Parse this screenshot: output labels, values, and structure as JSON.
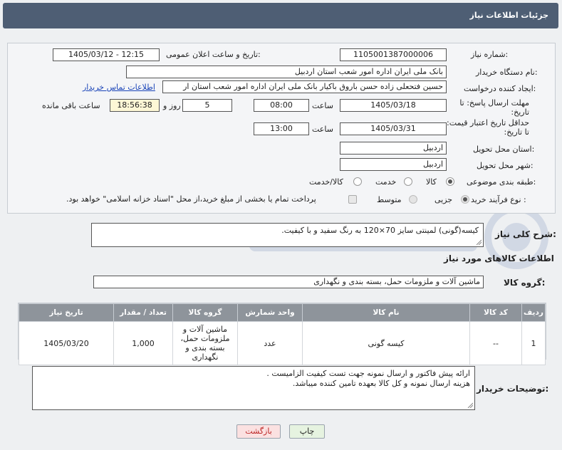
{
  "header": {
    "title": "جزئیات اطلاعات نیاز"
  },
  "form": {
    "need_number_label": "شماره نیاز:",
    "need_number": "1105001387000006",
    "announce_label": "تاریخ و ساعت اعلان عمومی:",
    "announce_value": "1405/03/12 - 12:15",
    "buyer_org_label": "نام دستگاه خریدار:",
    "buyer_org": "بانک ملی ایران اداره امور شعب استان اردبیل",
    "creator_label": "ایجاد کننده درخواست:",
    "creator": "حسین فتحعلی زاده حسن باروق باکیار بانک ملی ایران اداره امور شعب استان ار",
    "contact_link": "اطلاعات تماس خریدار",
    "deadline_label": "مهلت ارسال پاسخ: تا تاریخ:",
    "deadline_date": "1405/03/18",
    "time_label": "ساعت",
    "deadline_time": "08:00",
    "days_value": "5",
    "days_label": "روز و",
    "remaining_value": "18:56:38",
    "remaining_label": "ساعت باقی مانده",
    "validity_label": "حداقل تاریخ اعتبار قیمت: تا تاریخ:",
    "validity_date": "1405/03/31",
    "validity_time": "13:00",
    "province_label": "استان محل تحویل:",
    "province": "اردبیل",
    "city_label": "شهر محل تحویل:",
    "city": "اردبیل",
    "category_label": "طبقه بندی موضوعی:",
    "category_options": [
      "کالا",
      "خدمت",
      "کالا/خدمت"
    ],
    "process_label": "نوع فرآیند خرید :",
    "process_options": [
      "جزیی",
      "متوسط"
    ],
    "payment_note": "پرداخت تمام یا بخشی از مبلغ خرید،از محل \"اسناد خزانه اسلامی\" خواهد بود."
  },
  "summary": {
    "label": "شرح کلی نیاز:",
    "text": "کیسه(گونی) لمینتی سایز 70×120 به رنگ سفید و با کیفیت."
  },
  "goods": {
    "section_title": "اطلاعات کالاهای مورد نیاز",
    "group_label": "گروه کالا:",
    "group_value": "ماشین آلات و ملزومات حمل، بسته بندی و نگهداری"
  },
  "table": {
    "headers": [
      "ردیف",
      "کد کالا",
      "نام کالا",
      "واحد شمارش",
      "گروه کالا",
      "تعداد / مقدار",
      "تاریخ نیاز"
    ],
    "rows": [
      [
        "1",
        "--",
        "کیسه گونی",
        "عدد",
        "ماشین آلات و ملزومات حمل، بسته بندی و نگهداری",
        "1,000",
        "1405/03/20"
      ]
    ]
  },
  "notes": {
    "label": "توضیحات خریدار:",
    "line1": "ارائه پیش فاکتور و ارسال نمونه جهت تست کیفیت الزامیست .",
    "line2": "هزینه ارسال نمونه و کل کالا بعهده تامین کننده میباشد."
  },
  "buttons": {
    "print": "چاپ",
    "back": "بازگشت"
  },
  "colors": {
    "title_bar": "#4e5e74",
    "table_header": "#8e949b",
    "link": "#1a44b8"
  }
}
